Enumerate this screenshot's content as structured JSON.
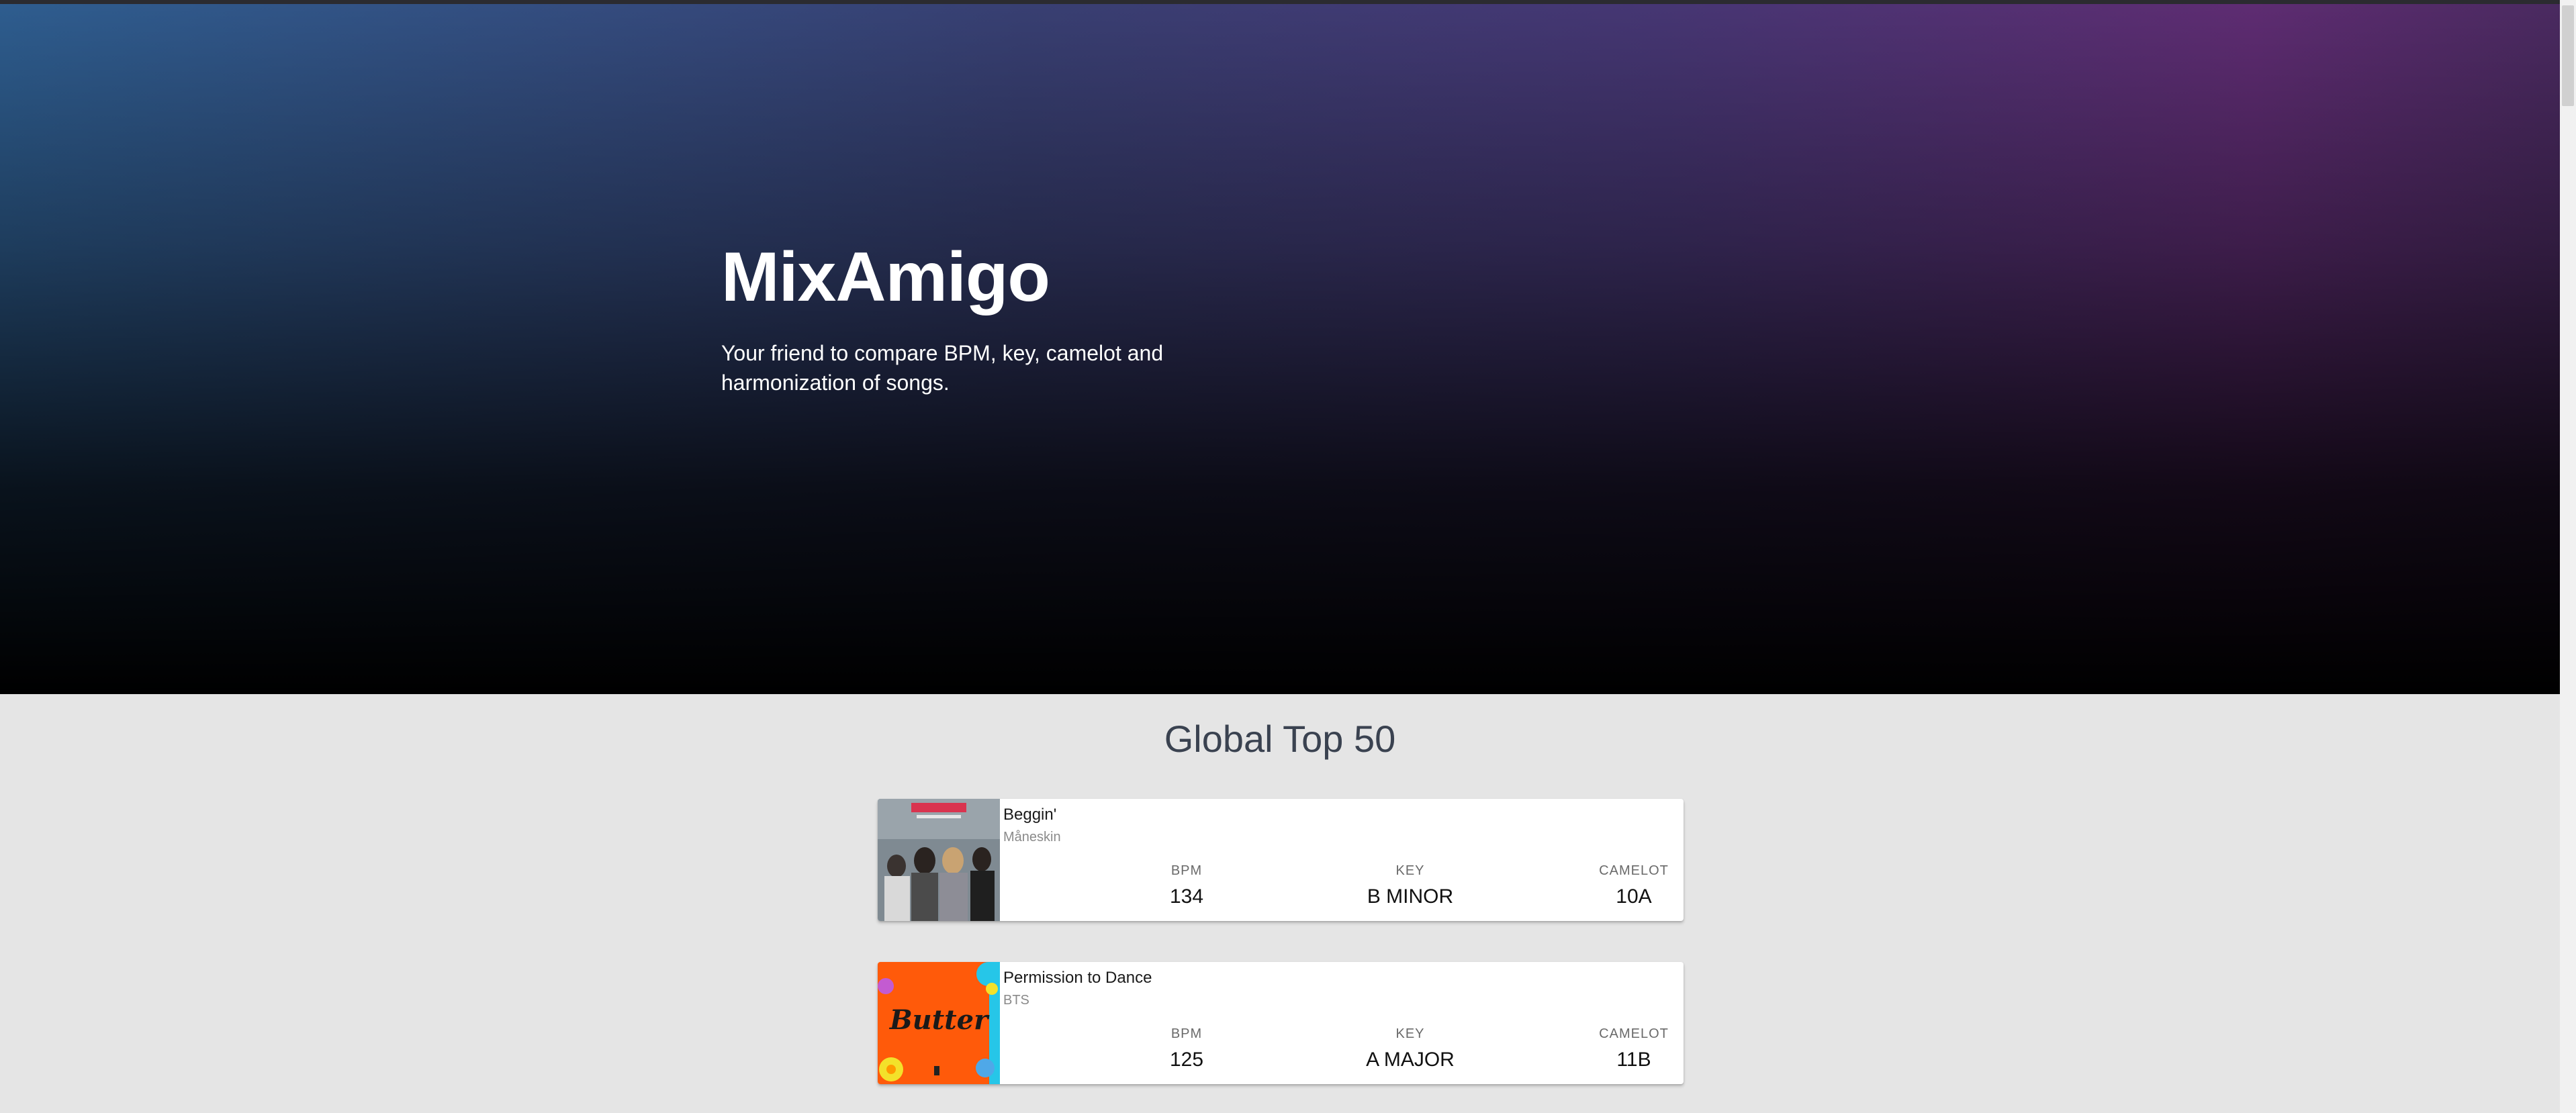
{
  "hero": {
    "title": "MixAmigo",
    "subtitle": "Your friend to compare BPM, key, camelot and harmonization of songs."
  },
  "section": {
    "title": "Global Top 50"
  },
  "tracks": [
    {
      "title": "Beggin'",
      "artist": "Måneskin",
      "bpm_label": "BPM",
      "bpm": "134",
      "key_label": "KEY",
      "key": "B MINOR",
      "camelot_label": "CAMELOT",
      "camelot": "10A"
    },
    {
      "title": "Permission to Dance",
      "artist": "BTS",
      "bpm_label": "BPM",
      "bpm": "125",
      "key_label": "KEY",
      "key": "A MAJOR",
      "camelot_label": "CAMELOT",
      "camelot": "11B",
      "cover_text": "Butter"
    }
  ],
  "colors": {
    "hero_left": "#2e5d8f",
    "hero_right": "#5e2c72",
    "page_bg": "#e5e5e5",
    "card_bg": "#ffffff"
  }
}
